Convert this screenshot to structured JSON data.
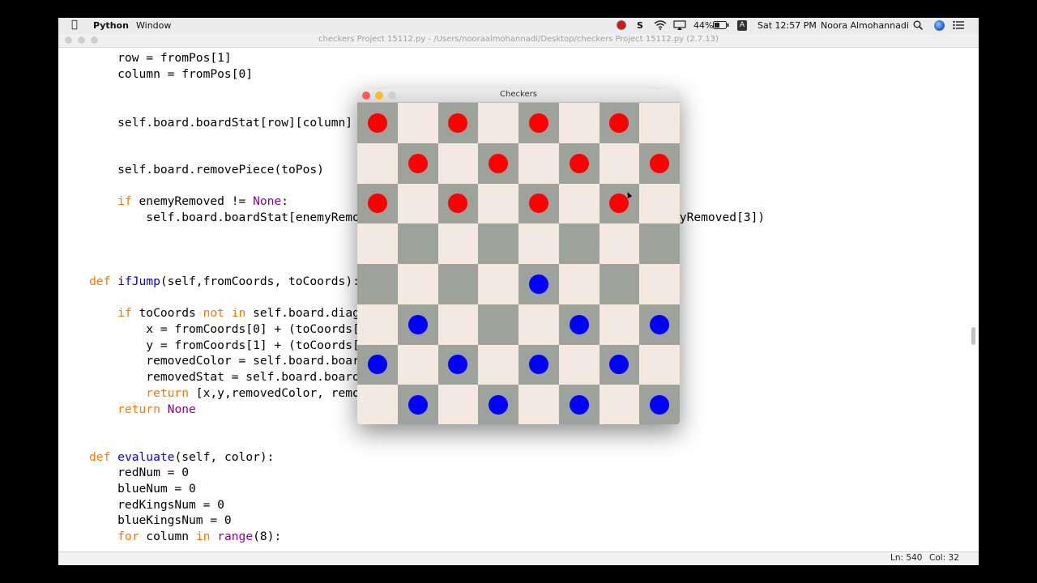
{
  "menubar": {
    "apple": "",
    "app": "Python",
    "menu_window": "Window",
    "status_s": "S",
    "battery": "44%",
    "input_source": "A",
    "clock": "Sat 12:57 PM",
    "user": "Noora Almohannadi"
  },
  "editor": {
    "title": "checkers Project 15112.py - /Users/nooraalmohannadi/Desktop/checkers Project 15112.py (2.7.13)",
    "lines": [
      [
        [
          "",
          "    row = fromPos[1]"
        ]
      ],
      [
        [
          "",
          "    column = fromPos[0]"
        ]
      ],
      [
        [
          "",
          "    self.board.boardStat[row][column] ="
        ]
      ],
      [
        [
          "",
          "    self.board.removePiece(toPos)"
        ]
      ],
      [
        [
          "kw",
          "    if"
        ],
        [
          "",
          " enemyRemoved != "
        ],
        [
          "bi",
          "None"
        ],
        [
          "",
          ":"
        ]
      ],
      [
        [
          "",
          "        self.board.boardStat[enemyRemov"
        ]
      ],
      [
        [
          "kw",
          "def"
        ],
        [
          "",
          " "
        ],
        [
          "df",
          "ifJump"
        ],
        [
          "",
          "(self,fromCoords, toCoords):"
        ]
      ],
      [
        [
          "kw",
          "    if"
        ],
        [
          "",
          " toCoords "
        ],
        [
          "kw",
          "not in"
        ],
        [
          "",
          " self.board.diago"
        ]
      ],
      [
        [
          "",
          "        x = fromCoords[0] + (toCoords[0"
        ]
      ],
      [
        [
          "",
          "        y = fromCoords[1] + (toCoords[1"
        ]
      ],
      [
        [
          "",
          "        removedColor = self.board.board"
        ]
      ],
      [
        [
          "",
          "        removedStat = self.board.boardS"
        ]
      ],
      [
        [
          "kw",
          "        return"
        ],
        [
          "",
          " [x,y,removedColor, remov"
        ]
      ],
      [
        [
          "kw",
          "    return"
        ],
        [
          "",
          " "
        ],
        [
          "bi",
          "None"
        ]
      ],
      [
        [
          "kw",
          "def"
        ],
        [
          "",
          " "
        ],
        [
          "df",
          "evaluate"
        ],
        [
          "",
          "(self, color):"
        ]
      ],
      [
        [
          "",
          "    redNum = 0"
        ]
      ],
      [
        [
          "",
          "    blueNum = 0"
        ]
      ],
      [
        [
          "",
          "    redKingsNum = 0"
        ]
      ],
      [
        [
          "",
          "    blueKingsNum = 0"
        ]
      ],
      [
        [
          "kw",
          "    for"
        ],
        [
          "",
          " column "
        ],
        [
          "kw",
          "in"
        ],
        [
          "",
          " "
        ],
        [
          "bi",
          "range"
        ],
        [
          "",
          "(8):"
        ]
      ]
    ],
    "right_fragment": "nyRemoved[3])",
    "status": {
      "ln": "Ln: 540",
      "col": "Col: 32"
    }
  },
  "checkers": {
    "title": "Checkers",
    "colors": {
      "light": "#f3e9e1",
      "dark": "#9da29a",
      "red": "#ff0000",
      "blue": "#0000ff"
    },
    "board": [
      "r.r.r.r.",
      ".r.r.r.r",
      "r.r.r.r.",
      "........",
      "....b...",
      ".b...b.b",
      "b.b.b.b.",
      ".b.b.b.b"
    ]
  }
}
